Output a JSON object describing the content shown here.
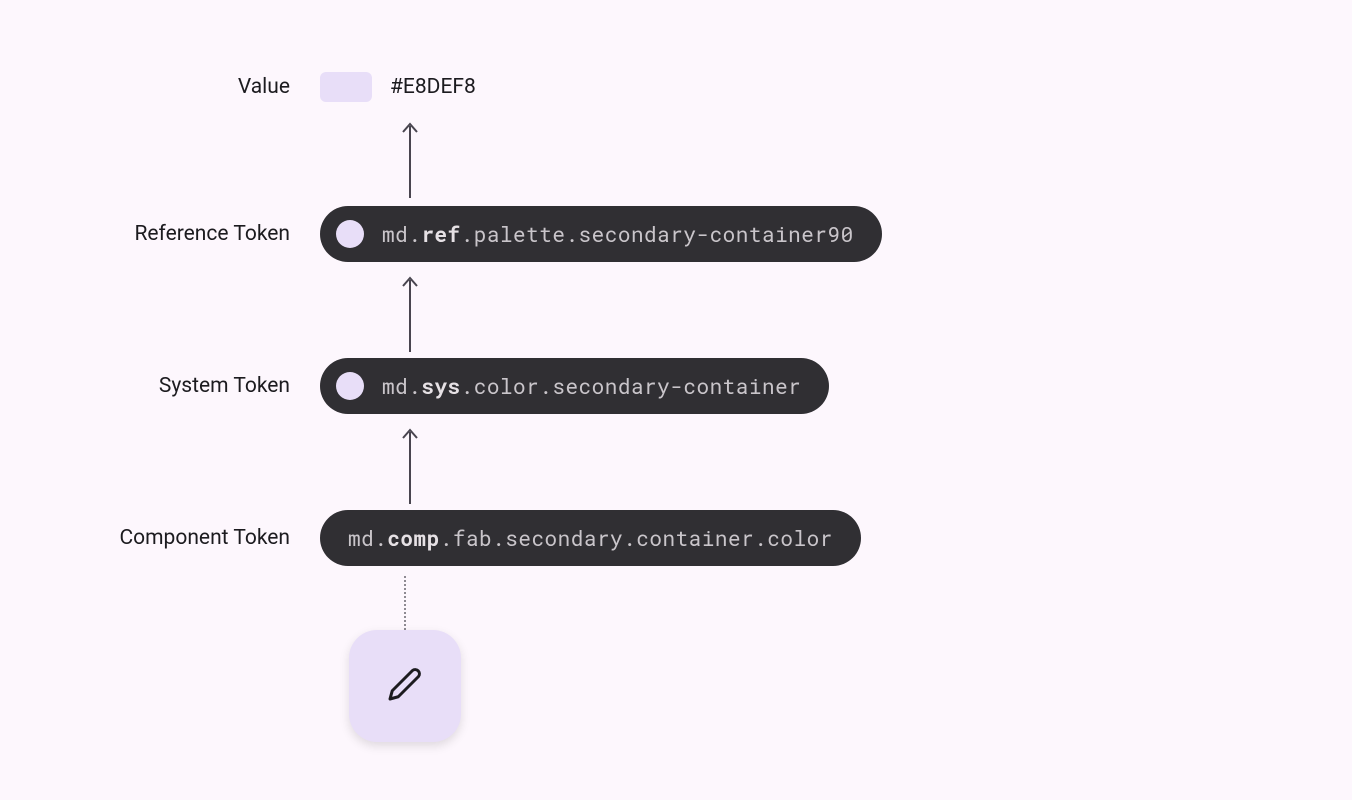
{
  "rows": {
    "value": {
      "label": "Value",
      "hex": "#E8DEF8"
    },
    "reference": {
      "label": "Reference Token",
      "token_pre": "md.",
      "token_bold": "ref",
      "token_post": ".palette.secondary-container90"
    },
    "system": {
      "label": "System Token",
      "token_pre": "md.",
      "token_bold": "sys",
      "token_post": ".color.secondary-container"
    },
    "component": {
      "label": "Component Token",
      "token_pre": "md.",
      "token_bold": "comp",
      "token_post": ".fab.secondary.container.color"
    }
  },
  "swatch_color": "#E8DEF8"
}
